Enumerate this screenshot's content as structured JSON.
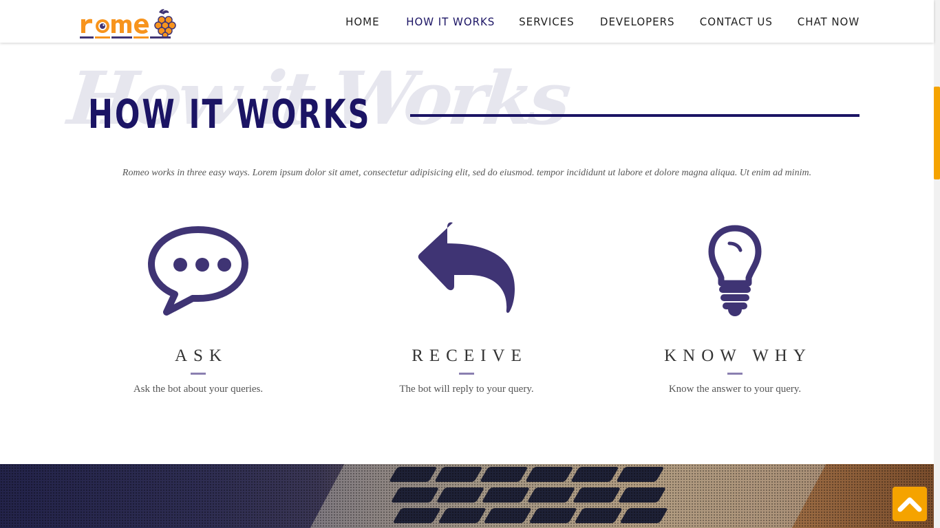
{
  "brand": {
    "logo_text": "romeo",
    "colors": {
      "orange": "#f7941d",
      "navy": "#1b1464",
      "purple": "#3f3474",
      "scroll_accent": "#f5a300"
    }
  },
  "nav": {
    "items": [
      {
        "label": "HOME"
      },
      {
        "label": "HOW IT WORKS",
        "active": true
      },
      {
        "label": "SERVICES"
      },
      {
        "label": "DEVELOPERS"
      },
      {
        "label": "CONTACT US"
      },
      {
        "label": "CHAT NOW"
      }
    ]
  },
  "section": {
    "script_title": "How it Works",
    "title": "HOW IT WORKS",
    "intro": "Romeo works in three easy ways. Lorem ipsum dolor sit amet, consectetur adipisicing elit, sed do eiusmod. tempor incididunt ut labore et dolore magna aliqua. Ut enim ad minim."
  },
  "steps": [
    {
      "icon": "speech-bubble-icon",
      "title": "ASK",
      "desc": "Ask the bot about your queries."
    },
    {
      "icon": "reply-arrow-icon",
      "title": "RECEIVE",
      "desc": "The bot will reply to your query."
    },
    {
      "icon": "lightbulb-icon",
      "title": "KNOW WHY",
      "desc": "Know the answer to your query."
    }
  ],
  "back_to_top": {
    "icon": "chevron-up-icon"
  }
}
